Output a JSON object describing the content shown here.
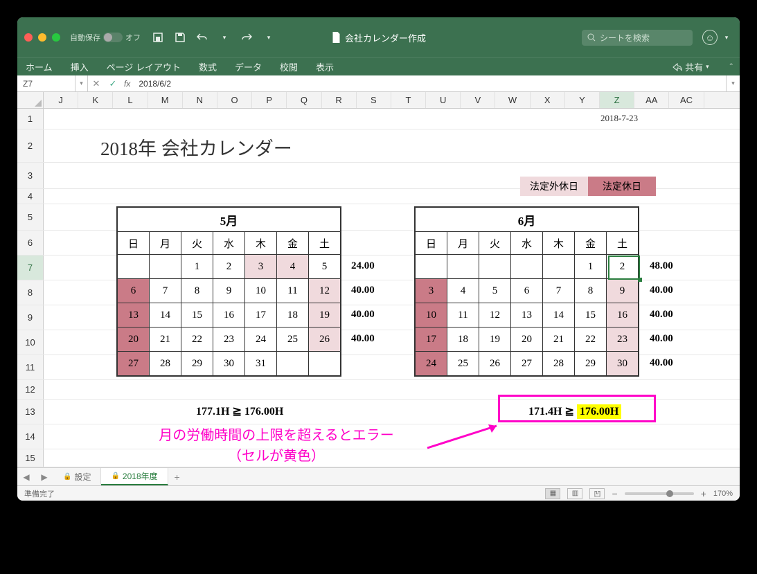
{
  "titlebar": {
    "autosave_label": "自動保存",
    "autosave_state": "オフ",
    "doc_title": "会社カレンダー作成",
    "search_placeholder": "シートを検索"
  },
  "ribbon": {
    "tabs": [
      "ホーム",
      "挿入",
      "ページ レイアウト",
      "数式",
      "データ",
      "校閲",
      "表示"
    ],
    "share": "共有"
  },
  "formula_bar": {
    "name_box": "Z7",
    "formula": "2018/6/2"
  },
  "columns": [
    "J",
    "K",
    "L",
    "M",
    "N",
    "O",
    "P",
    "Q",
    "R",
    "S",
    "T",
    "U",
    "V",
    "W",
    "X",
    "Y",
    "Z",
    "AA",
    "AC"
  ],
  "active_col": "Z",
  "rows": [
    "1",
    "2",
    "3",
    "4",
    "5",
    "6",
    "7",
    "8",
    "9",
    "10",
    "11",
    "12",
    "13",
    "14",
    "15"
  ],
  "active_row": "7",
  "doc_date": "2018-7-23",
  "calendar_title": "2018年 会社カレンダー",
  "legend": {
    "non_statutory": "法定外休日",
    "statutory": "法定休日"
  },
  "dow": [
    "日",
    "月",
    "火",
    "水",
    "木",
    "金",
    "土"
  ],
  "may": {
    "title": "5月",
    "weeks": [
      [
        "",
        "",
        "1",
        "2",
        "3",
        "4",
        "5"
      ],
      [
        "6",
        "7",
        "8",
        "9",
        "10",
        "11",
        "12"
      ],
      [
        "13",
        "14",
        "15",
        "16",
        "17",
        "18",
        "19"
      ],
      [
        "20",
        "21",
        "22",
        "23",
        "24",
        "25",
        "26"
      ],
      [
        "27",
        "28",
        "29",
        "30",
        "31",
        "",
        ""
      ]
    ],
    "hours": [
      "24.00",
      "40.00",
      "40.00",
      "40.00"
    ],
    "total": "177.1H ≧ 176.00H"
  },
  "jun": {
    "title": "6月",
    "weeks": [
      [
        "",
        "",
        "",
        "",
        "",
        "1",
        "2"
      ],
      [
        "3",
        "4",
        "5",
        "6",
        "7",
        "8",
        "9"
      ],
      [
        "10",
        "11",
        "12",
        "13",
        "14",
        "15",
        "16"
      ],
      [
        "17",
        "18",
        "19",
        "20",
        "21",
        "22",
        "23"
      ],
      [
        "24",
        "25",
        "26",
        "27",
        "28",
        "29",
        "30"
      ]
    ],
    "hours": [
      "48.00",
      "40.00",
      "40.00",
      "40.00",
      "40.00"
    ],
    "total_left": "171.4H ≧",
    "total_right": "176.00H"
  },
  "annotation": {
    "line1": "月の労働時間の上限を超えるとエラー",
    "line2": "（セルが黄色）"
  },
  "sheet_tabs": {
    "tab1": "設定",
    "tab2": "2018年度"
  },
  "status": {
    "ready": "準備完了",
    "zoom": "170%"
  }
}
